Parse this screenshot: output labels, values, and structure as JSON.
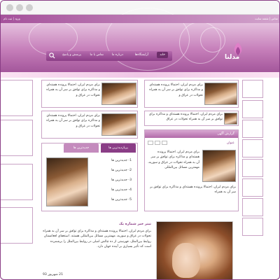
{
  "topbar": {
    "right_text": "ورود | ثبت نام",
    "left_text": "تماس | نقشه سایت"
  },
  "logo": {
    "text": "مدلنا"
  },
  "nav": {
    "items": [
      "خانه",
      "آرایشگاه‌ها",
      "درباره ما",
      "تماس با ما",
      "پرسش و پاسخ"
    ],
    "active_index": 0
  },
  "articles": {
    "top_left": "برای مردم ایران، احتمالا پرونده هسته‌ای و مذاکره برای توافق بر سر آن به همراه تحولات در عراق و",
    "mid_left": "برای مردم ایران، احتمالا پرونده هسته‌ای و مذاکره برای توافق بر سر آن به همراه تحولات در عراق و",
    "top_right": "برای مردم ایران، احتمالا پرونده هسته‌ای و مذاکره برای توافق بر سر آن به همراه تحولات در عراق و",
    "mid_right": "برای مردم ایران، احتمالا پرونده هسته‌ای و مذاکره برای توافق بر سر آن به همراه تحولات در عراق"
  },
  "tabs": {
    "active": "پربازدیدترین ها",
    "inactive": "جدیدترین ها"
  },
  "list": [
    "1- جدیدترین ها",
    "2- جدیدترین ها",
    "3- جدیدترین ها",
    "4- جدیدترین ها",
    "5- جدیدترین ها"
  ],
  "ads": {
    "header": "گزارش آگهی",
    "title_label": "عنوان",
    "body1": "برای مردم ایران، احتمالا پرونده هسته‌ای و مذاکره برای توافق بر سر آن به همراه تحولات در عراق و سوریه، مهمترین مسائل بین‌المللی",
    "body2": "برای مردم ایران، احتمالا پرونده هسته‌ای و مذاکره برای توافق بر سر آن به همراه"
  },
  "news": {
    "title": "تیتر خبر شماره یک",
    "body": "برای مردم ایران، احتمالا پرونده هسته‌ای و مذاکره برای توافق بر سر آن به همراه تحولات در عراق و سوریه، مهمترین مسائل بین‌المللی هستند. استعفای افغانستان روابط بین‌الملل، فهرستی از ده چالش اصلی در روابط بین‌الملل را برشمرده است که تأثیر بسیاری بر آینده جهان دارد.",
    "date": "21 شهریور 93"
  },
  "colors": {
    "brand": "#8a3d86",
    "accent": "#b16aa8",
    "tab_active": "#8a3d86",
    "tab_inactive": "#c48bbd"
  }
}
